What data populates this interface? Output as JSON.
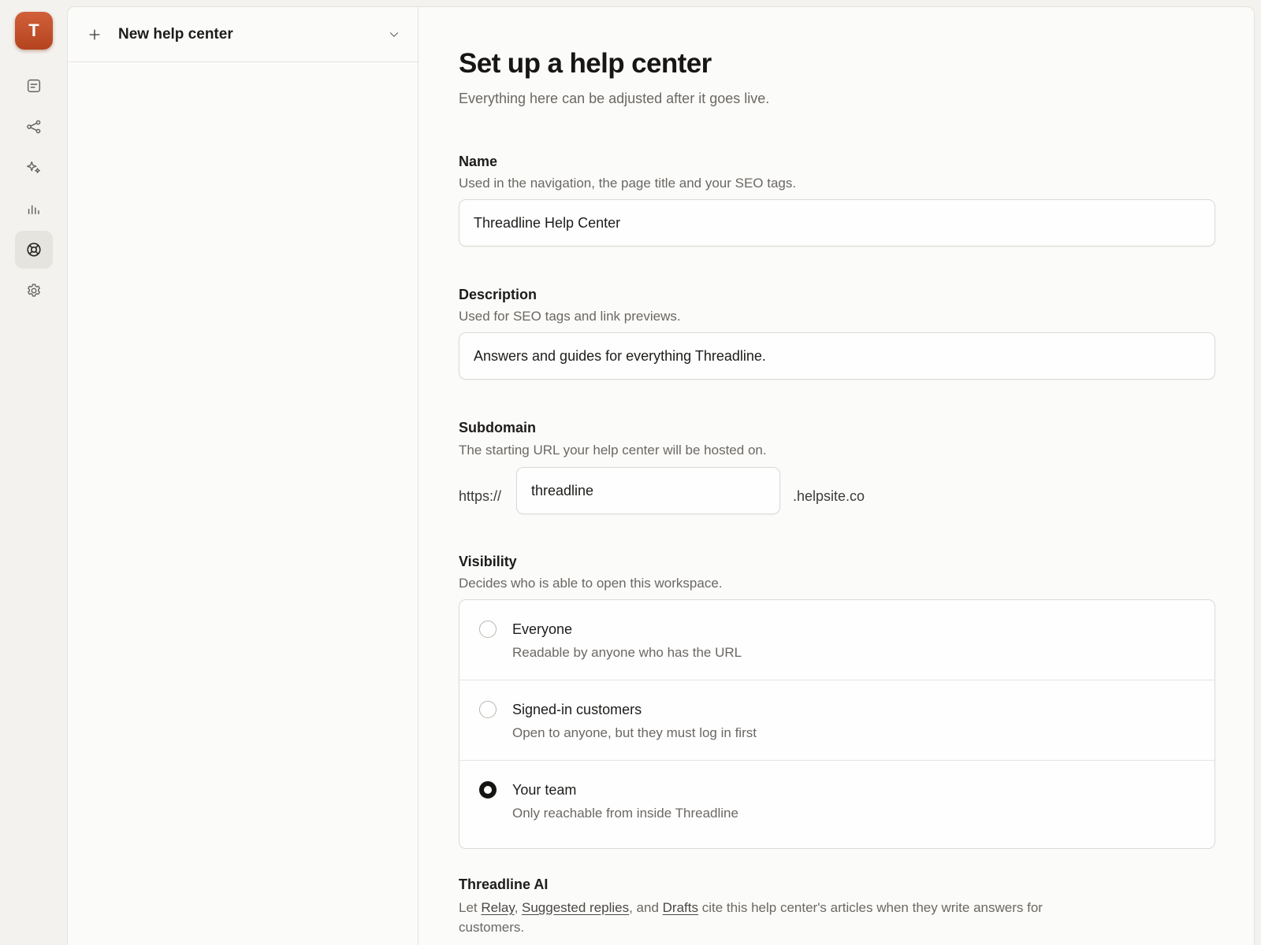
{
  "workspace": {
    "logo_letter": "T"
  },
  "rail": [
    {
      "icon": "document-icon"
    },
    {
      "icon": "share-icon"
    },
    {
      "icon": "sparkles-icon"
    },
    {
      "icon": "bar-chart-icon"
    },
    {
      "icon": "lifebuoy-icon",
      "active": true
    },
    {
      "icon": "gear-icon"
    }
  ],
  "left_panel": {
    "header_title": "New help center"
  },
  "page": {
    "title": "Set up a help center",
    "subtitle": "Everything here can be adjusted after it goes live."
  },
  "name": {
    "label": "Name",
    "hint": "Used in the navigation, the page title and your SEO tags.",
    "value": "Threadline Help Center"
  },
  "description": {
    "label": "Description",
    "hint": "Used for SEO tags and link previews.",
    "value": "Answers and guides for everything Threadline."
  },
  "subdomain": {
    "label": "Subdomain",
    "hint": "The starting URL your help center will be hosted on.",
    "prefix": "https://",
    "value": "threadline",
    "suffix": ".helpsite.co"
  },
  "visibility": {
    "label": "Visibility",
    "hint": "Decides who is able to open this workspace.",
    "options": [
      {
        "title": "Everyone",
        "desc": "Readable by anyone who has the URL",
        "selected": false
      },
      {
        "title": "Signed-in customers",
        "desc": "Open to anyone, but they must log in first",
        "selected": false
      },
      {
        "title": "Your team",
        "desc": "Only reachable from inside Threadline",
        "selected": true
      }
    ]
  },
  "ai": {
    "label": "Threadline AI",
    "text_before": "Let ",
    "link1": "Relay",
    "sep1": ", ",
    "link2": "Suggested replies",
    "sep2": ", and ",
    "link3": "Drafts",
    "text_after": " cite this help center's articles when they write answers for customers."
  },
  "colors": {
    "brand": "#c4512a",
    "active_rail_bg": "#e6e4df"
  }
}
